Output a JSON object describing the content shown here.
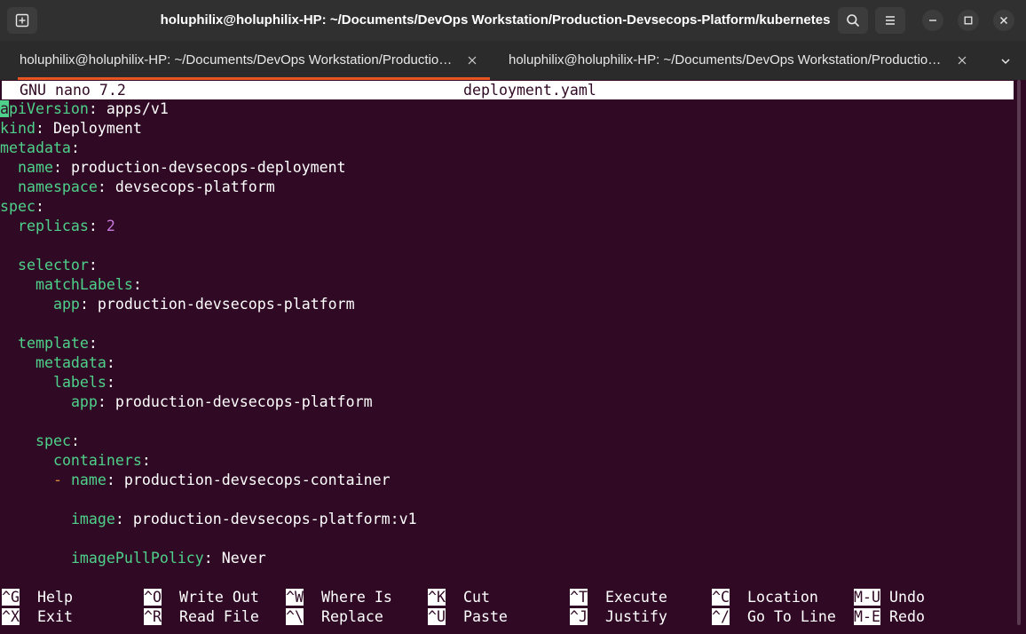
{
  "window": {
    "title": "holuphilix@holuphilix-HP: ~/Documents/DevOps Workstation/Production-Devsecops-Platform/kubernetes"
  },
  "tabs": [
    {
      "label": "holuphilix@holuphilix-HP: ~/Documents/DevOps Workstation/Productio…",
      "active": true
    },
    {
      "label": "holuphilix@holuphilix-HP: ~/Documents/DevOps Workstation/Productio…",
      "active": false
    }
  ],
  "nano": {
    "version": "GNU nano 7.2",
    "filename": "deployment.yaml",
    "lines": [
      {
        "indent": "",
        "cursor": "a",
        "key": "piVersion",
        "sep": ": ",
        "value": "apps/v1"
      },
      {
        "indent": "",
        "key": "kind",
        "sep": ": ",
        "value": "Deployment"
      },
      {
        "indent": "",
        "key": "metadata",
        "sep": ":",
        "value": ""
      },
      {
        "indent": "  ",
        "key": "name",
        "sep": ": ",
        "value": "production-devsecops-deployment"
      },
      {
        "indent": "  ",
        "key": "namespace",
        "sep": ": ",
        "value": "devsecops-platform"
      },
      {
        "indent": "",
        "key": "spec",
        "sep": ":",
        "value": ""
      },
      {
        "indent": "  ",
        "key": "replicas",
        "sep": ": ",
        "number": "2"
      },
      {
        "indent": "",
        "key": "",
        "sep": "",
        "value": ""
      },
      {
        "indent": "  ",
        "key": "selector",
        "sep": ":",
        "value": ""
      },
      {
        "indent": "    ",
        "key": "matchLabels",
        "sep": ":",
        "value": ""
      },
      {
        "indent": "      ",
        "key": "app",
        "sep": ": ",
        "value": "production-devsecops-platform"
      },
      {
        "indent": "",
        "key": "",
        "sep": "",
        "value": ""
      },
      {
        "indent": "  ",
        "key": "template",
        "sep": ":",
        "value": ""
      },
      {
        "indent": "    ",
        "key": "metadata",
        "sep": ":",
        "value": ""
      },
      {
        "indent": "      ",
        "key": "labels",
        "sep": ":",
        "value": ""
      },
      {
        "indent": "        ",
        "key": "app",
        "sep": ": ",
        "value": "production-devsecops-platform"
      },
      {
        "indent": "",
        "key": "",
        "sep": "",
        "value": ""
      },
      {
        "indent": "    ",
        "key": "spec",
        "sep": ":",
        "value": ""
      },
      {
        "indent": "      ",
        "key": "containers",
        "sep": ":",
        "value": ""
      },
      {
        "indent": "      ",
        "dash": "- ",
        "key": "name",
        "sep": ": ",
        "value": "production-devsecops-container"
      },
      {
        "indent": "",
        "key": "",
        "sep": "",
        "value": ""
      },
      {
        "indent": "        ",
        "key": "image",
        "sep": ": ",
        "value": "production-devsecops-platform:v1"
      },
      {
        "indent": "",
        "key": "",
        "sep": "",
        "value": ""
      },
      {
        "indent": "        ",
        "key": "imagePullPolicy",
        "sep": ": ",
        "value": "Never"
      }
    ],
    "shortcuts_row1": [
      {
        "key": "^G",
        "label": "Help"
      },
      {
        "key": "^O",
        "label": "Write Out"
      },
      {
        "key": "^W",
        "label": "Where Is"
      },
      {
        "key": "^K",
        "label": "Cut"
      },
      {
        "key": "^T",
        "label": "Execute"
      },
      {
        "key": "^C",
        "label": "Location"
      },
      {
        "key": "M-U",
        "label": "Undo"
      }
    ],
    "shortcuts_row2": [
      {
        "key": "^X",
        "label": "Exit"
      },
      {
        "key": "^R",
        "label": "Read File"
      },
      {
        "key": "^\\",
        "label": "Replace"
      },
      {
        "key": "^U",
        "label": "Paste"
      },
      {
        "key": "^J",
        "label": "Justify"
      },
      {
        "key": "^/",
        "label": "Go To Line"
      },
      {
        "key": "M-E",
        "label": "Redo"
      }
    ]
  },
  "icons": {
    "new_tab": "new-tab-icon",
    "search": "search-icon",
    "menu": "hamburger-menu-icon",
    "minimize": "minimize-icon",
    "maximize": "maximize-icon",
    "close": "close-icon",
    "tab_close": "tab-close-icon",
    "tab_overflow": "chevron-down-icon"
  },
  "colors": {
    "terminal_bg": "#300a24",
    "yaml_key": "#4ed18a",
    "yaml_number": "#c678dd",
    "yaml_dash": "#e08a3c",
    "tab_indicator": "#e95420"
  }
}
